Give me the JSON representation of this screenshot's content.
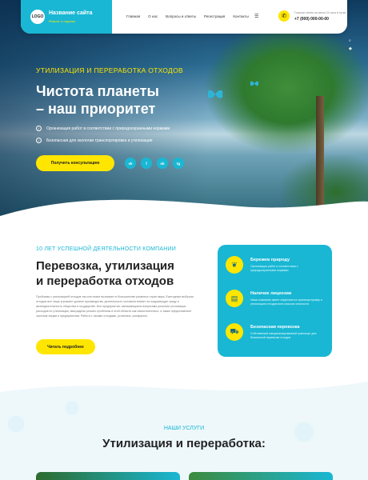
{
  "header": {
    "logo": "LOGO",
    "site_name": "Название сайта",
    "tagline": "Ремонт и отделка",
    "nav": [
      "Главная",
      "О нас",
      "Вопросы и ответы",
      "Регистрация",
      "Контакты"
    ],
    "phone_label": "Горячая линия на связи 24 часа в сутки",
    "phone": "+7 (000) 000-00-00"
  },
  "hero": {
    "subtitle": "УТИЛИЗАЦИЯ И ПЕРЕРАБОТКА ОТХОДОВ",
    "title_line1": "Чистота планеты",
    "title_line2": "– наш приоритет",
    "checks": [
      "Организация работ в соответствии с природоохранными нормами",
      "Безопасная для экологии транспортировка и утилизация"
    ],
    "cta": "Получить консультацию",
    "socials": [
      "vk",
      "f",
      "ok",
      "tg"
    ]
  },
  "about": {
    "subtitle": "10 ЛЕТ УСПЕШНОЙ ДЕЯТЕЛЬНОСТИ КОМПАНИИ",
    "title_line1": "Перевозка, утилизация",
    "title_line2": "и переработка отходов",
    "text": "Проблема с утилизацией отходов так или иначе возникает в большинстве развитых стран мира. Ежегодные выбросы отходов все чаще угрожают уровню производства, деятельность человека влияет на окружающую среду и жизнедеятельность общества в государстве. Все предприятия, занимающиеся вопросами решения утилизации расходов по утилизации, вынуждены решать проблемы в этой области как самостоятельно, а также предоставляют частным лицам и предприятиям. Работа с такими отходами, установок, комфортно.",
    "more_button": "Читать подробнее"
  },
  "features": [
    {
      "icon": "hands-leaf-icon",
      "title": "Бережем природу",
      "text": "Организация работ в соответствии с природоохранными нормами"
    },
    {
      "icon": "license-icon",
      "title": "Наличие лицензии",
      "text": "Наша компания имеет лицензию на транспортировку и утилизацию отходов всех классов опасности"
    },
    {
      "icon": "truck-icon",
      "title": "Безопасная перевозка",
      "text": "Собственный специализированный транспорт для безопасной перевозки отходов"
    }
  ],
  "services": {
    "subtitle": "НАШИ УСЛУГИ",
    "title": "Утилизация и переработка:"
  },
  "colors": {
    "accent": "#19b7d4",
    "highlight": "#ffe600"
  }
}
